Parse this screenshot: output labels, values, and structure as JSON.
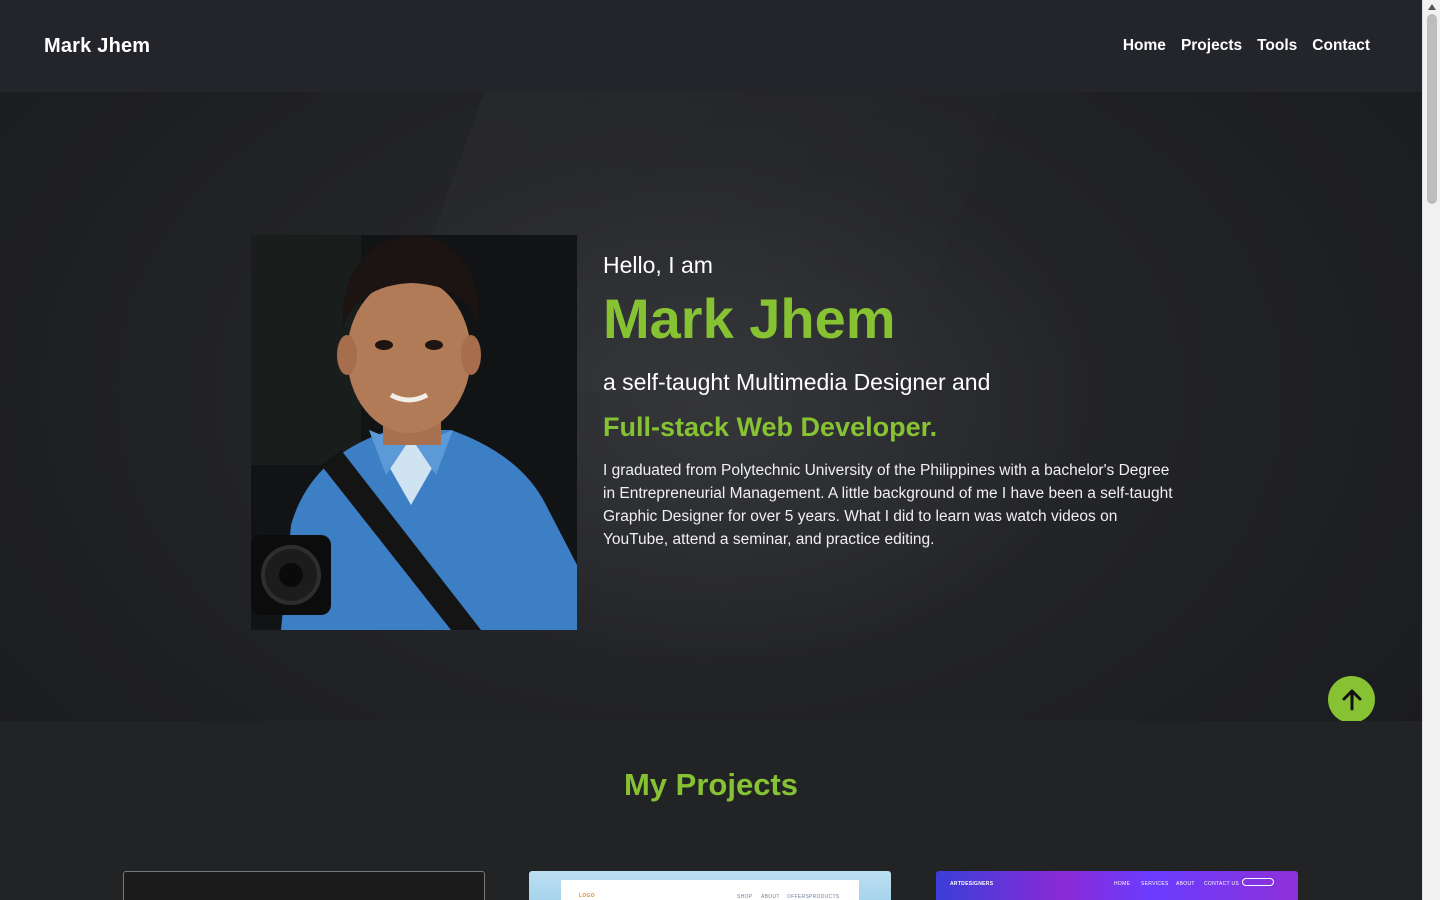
{
  "header": {
    "brand": "Mark Jhem",
    "nav": [
      "Home",
      "Projects",
      "Tools",
      "Contact"
    ]
  },
  "hero": {
    "greeting": "Hello, I am",
    "name": "Mark Jhem",
    "tagline_1": "a self-taught Multimedia Designer and",
    "tagline_2": "Full-stack Web Developer.",
    "bio": "I graduated from Polytechnic University of the Philippines with a bachelor's Degree in Entrepreneurial Management. A little background of me I have been a self-taught Graphic Designer for over 5 years. What I did to learn was watch videos on YouTube, attend a seminar, and practice editing."
  },
  "projects": {
    "title": "My Projects",
    "card2_thumb": {
      "logo": "LOGO",
      "nav": [
        "SHOP",
        "ABOUT",
        "OFFERS",
        "PRODUCTS"
      ]
    },
    "card3_thumb": {
      "logo": "ARTDESIGNERS",
      "nav": [
        "HOME",
        "SERVICES",
        "ABOUT",
        "CONTACT US"
      ]
    }
  },
  "colors": {
    "accent": "#86c232",
    "header_bg": "#23252a",
    "page_bg": "#222325"
  },
  "icons": {
    "back_to_top": "arrow-up-icon",
    "scroll_up": "triangle-up-icon"
  }
}
